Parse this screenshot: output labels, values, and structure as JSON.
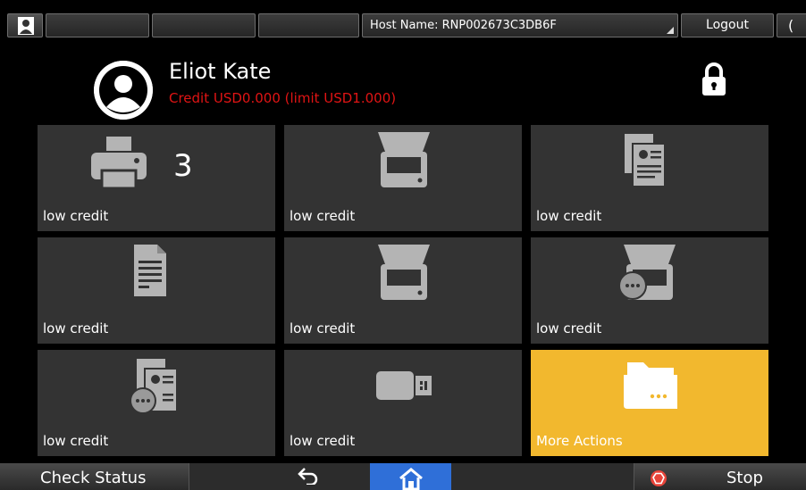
{
  "topbar": {
    "host_label": "Host Name: RNP002673C3DB6F",
    "logout_label": "Logout",
    "moon_glyph": "("
  },
  "user": {
    "name": "Eliot Kate",
    "credit": "Credit USD0.000 (limit USD1.000)"
  },
  "tiles": [
    {
      "icon": "printer-icon",
      "label": "low credit",
      "count": "3"
    },
    {
      "icon": "scanner-icon",
      "label": "low credit"
    },
    {
      "icon": "copy-icon",
      "label": "low credit"
    },
    {
      "icon": "document-icon",
      "label": "low credit"
    },
    {
      "icon": "scanner-icon",
      "label": "low credit"
    },
    {
      "icon": "scan-to-network-icon",
      "label": "low credit"
    },
    {
      "icon": "copy-to-network-icon",
      "label": "low credit"
    },
    {
      "icon": "usb-icon",
      "label": "low credit"
    },
    {
      "icon": "folder-more-icon",
      "label": "More Actions"
    }
  ],
  "bottombar": {
    "check_status_label": "Check Status",
    "stop_label": "Stop"
  },
  "colors": {
    "tile_bg": "#333333",
    "accent": "#f2b82e",
    "credit_text": "#e01414",
    "home_button": "#2f6fd8"
  }
}
